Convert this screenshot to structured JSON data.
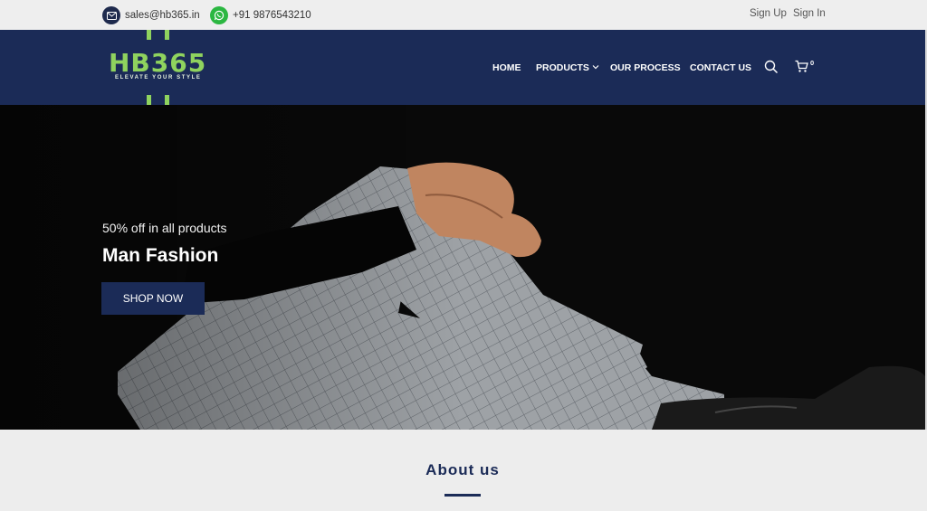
{
  "topbar": {
    "email": "sales@hb365.in",
    "phone": "+91 9876543210",
    "signup": "Sign Up",
    "signin": "Sign In"
  },
  "logo": {
    "text": "HB365",
    "tagline": "ELEVATE YOUR STYLE"
  },
  "nav": {
    "items": [
      {
        "label": "HOME"
      },
      {
        "label": "PRODUCTS"
      },
      {
        "label": "OUR PROCESS"
      },
      {
        "label": "CONTACT US"
      }
    ],
    "cart_count": "0"
  },
  "hero": {
    "subtitle": "50% off in all products",
    "title": "Man Fashion",
    "button": "SHOP NOW"
  },
  "about": {
    "title": "About us"
  },
  "colors": {
    "brand_navy": "#1b2b57",
    "logo_green": "#8fd35e",
    "whatsapp_green": "#2bb741"
  }
}
